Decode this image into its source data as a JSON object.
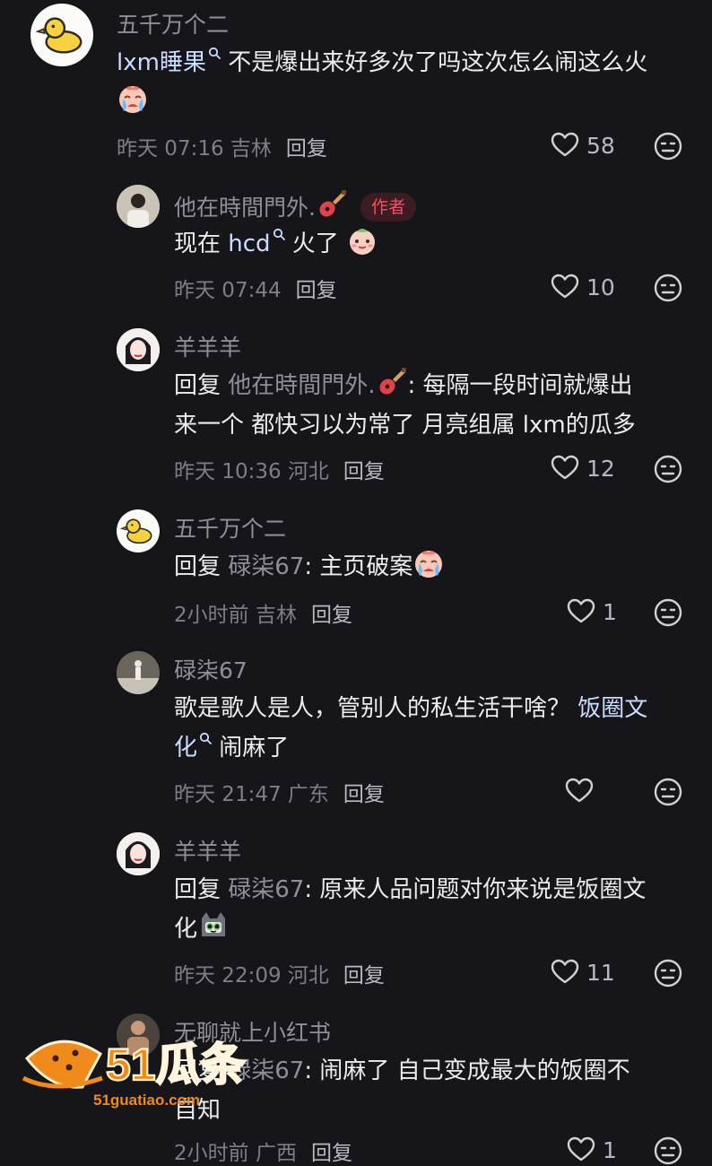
{
  "comments": [
    {
      "user": "五千万个二",
      "text_pre": "lxm睡果",
      "text_post": " 不是爆出来好多次了吗这次怎么闹这么火",
      "time": "昨天 07:16 吉林",
      "reply": "回复",
      "likes": "58"
    },
    {
      "user": "他在時間門外.",
      "badge": "作者",
      "text_pre": "现在 ",
      "link": "hcd",
      "text_post": " 火了",
      "time": "昨天 07:44",
      "reply": "回复",
      "likes": "10"
    },
    {
      "user": "羊羊羊",
      "reply_prefix": "回复 ",
      "ref_user": "他在時間門外.",
      "text_line1": ": 每隔一段时间就爆出",
      "text_line2": "来一个 都快习以为常了 月亮组属 lxm的瓜多",
      "time": "昨天 10:36 河北",
      "reply": "回复",
      "likes": "12"
    },
    {
      "user": "五千万个二",
      "reply_prefix": "回复 ",
      "ref_user": "碌柒67",
      "text": ": 主页破案",
      "time": "2小时前 吉林",
      "reply": "回复",
      "likes": "1"
    },
    {
      "user": "碌柒67",
      "text_line1": "歌是歌人是人，管别人的私生活干啥？ ",
      "link_part1": "饭圈文",
      "link_part2": "化",
      "text_post": " 闹麻了",
      "time": "昨天 21:47 广东",
      "reply": "回复",
      "likes": ""
    },
    {
      "user": "羊羊羊",
      "reply_prefix": "回复 ",
      "ref_user": "碌柒67",
      "text_line1": ": 原来人品问题对你来说是饭圈文",
      "text_line2": "化",
      "time": "昨天 22:09 河北",
      "reply": "回复",
      "likes": "11"
    },
    {
      "user": "无聊就上小红书",
      "reply_prefix": "回复 ",
      "ref_user": "碌柒67",
      "text_line1": ": 闹麻了 自己变成最大的饭圈不",
      "text_line2": "自知",
      "time": "2小时前 广西",
      "reply": "回复",
      "likes": "1"
    }
  ],
  "watermark": {
    "brand": "51瓜条",
    "url": "51guatiao.com"
  },
  "colors": {
    "background": "#16161a",
    "author_badge": "#ff4b60",
    "link": "#c9ddff"
  }
}
